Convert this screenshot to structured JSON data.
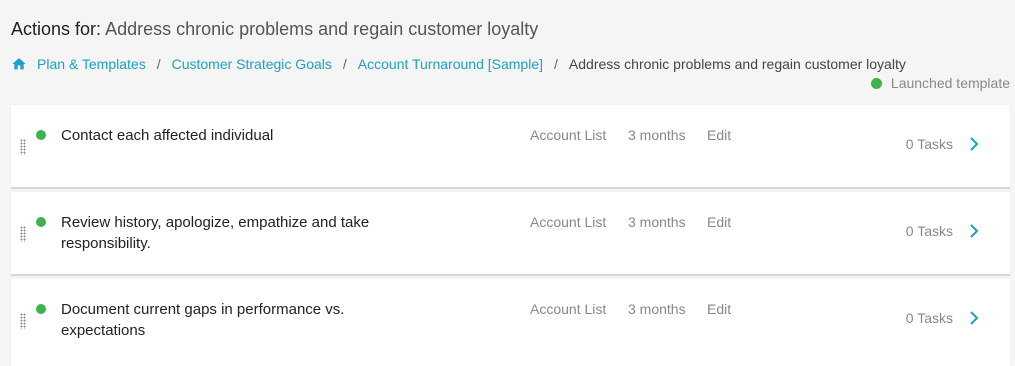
{
  "header": {
    "label": "Actions for:",
    "subject": "Address chronic problems and regain customer loyalty"
  },
  "breadcrumb": {
    "items": [
      "Plan & Templates",
      "Customer Strategic Goals",
      "Account Turnaround [Sample]"
    ],
    "separator": "/",
    "current": "Address chronic problems and regain customer loyalty"
  },
  "status": {
    "text": "Launched template",
    "color": "#3cb44b"
  },
  "actions": [
    {
      "title": "Contact each affected individual",
      "account": "Account List",
      "duration": "3 months",
      "edit": "Edit",
      "tasks": "0 Tasks"
    },
    {
      "title": "Review history, apologize, empathize and take responsibility.",
      "account": "Account List",
      "duration": "3 months",
      "edit": "Edit",
      "tasks": "0 Tasks"
    },
    {
      "title": "Document current gaps in performance vs. expectations",
      "account": "Account List",
      "duration": "3 months",
      "edit": "Edit",
      "tasks": "0 Tasks"
    }
  ],
  "colors": {
    "accent": "#1ea0c8",
    "status_green": "#3cb44b"
  },
  "icons": {
    "home": "home-icon",
    "drag": "drag-handle-icon",
    "chevron": "chevron-right-icon"
  }
}
